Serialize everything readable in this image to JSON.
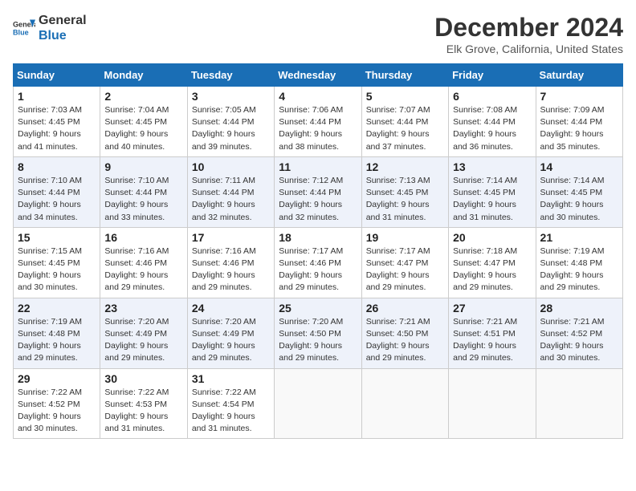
{
  "logo": {
    "line1": "General",
    "line2": "Blue"
  },
  "title": "December 2024",
  "location": "Elk Grove, California, United States",
  "days_of_week": [
    "Sunday",
    "Monday",
    "Tuesday",
    "Wednesday",
    "Thursday",
    "Friday",
    "Saturday"
  ],
  "weeks": [
    [
      {
        "day": "1",
        "info": "Sunrise: 7:03 AM\nSunset: 4:45 PM\nDaylight: 9 hours and 41 minutes."
      },
      {
        "day": "2",
        "info": "Sunrise: 7:04 AM\nSunset: 4:45 PM\nDaylight: 9 hours and 40 minutes."
      },
      {
        "day": "3",
        "info": "Sunrise: 7:05 AM\nSunset: 4:44 PM\nDaylight: 9 hours and 39 minutes."
      },
      {
        "day": "4",
        "info": "Sunrise: 7:06 AM\nSunset: 4:44 PM\nDaylight: 9 hours and 38 minutes."
      },
      {
        "day": "5",
        "info": "Sunrise: 7:07 AM\nSunset: 4:44 PM\nDaylight: 9 hours and 37 minutes."
      },
      {
        "day": "6",
        "info": "Sunrise: 7:08 AM\nSunset: 4:44 PM\nDaylight: 9 hours and 36 minutes."
      },
      {
        "day": "7",
        "info": "Sunrise: 7:09 AM\nSunset: 4:44 PM\nDaylight: 9 hours and 35 minutes."
      }
    ],
    [
      {
        "day": "8",
        "info": "Sunrise: 7:10 AM\nSunset: 4:44 PM\nDaylight: 9 hours and 34 minutes."
      },
      {
        "day": "9",
        "info": "Sunrise: 7:10 AM\nSunset: 4:44 PM\nDaylight: 9 hours and 33 minutes."
      },
      {
        "day": "10",
        "info": "Sunrise: 7:11 AM\nSunset: 4:44 PM\nDaylight: 9 hours and 32 minutes."
      },
      {
        "day": "11",
        "info": "Sunrise: 7:12 AM\nSunset: 4:44 PM\nDaylight: 9 hours and 32 minutes."
      },
      {
        "day": "12",
        "info": "Sunrise: 7:13 AM\nSunset: 4:45 PM\nDaylight: 9 hours and 31 minutes."
      },
      {
        "day": "13",
        "info": "Sunrise: 7:14 AM\nSunset: 4:45 PM\nDaylight: 9 hours and 31 minutes."
      },
      {
        "day": "14",
        "info": "Sunrise: 7:14 AM\nSunset: 4:45 PM\nDaylight: 9 hours and 30 minutes."
      }
    ],
    [
      {
        "day": "15",
        "info": "Sunrise: 7:15 AM\nSunset: 4:45 PM\nDaylight: 9 hours and 30 minutes."
      },
      {
        "day": "16",
        "info": "Sunrise: 7:16 AM\nSunset: 4:46 PM\nDaylight: 9 hours and 29 minutes."
      },
      {
        "day": "17",
        "info": "Sunrise: 7:16 AM\nSunset: 4:46 PM\nDaylight: 9 hours and 29 minutes."
      },
      {
        "day": "18",
        "info": "Sunrise: 7:17 AM\nSunset: 4:46 PM\nDaylight: 9 hours and 29 minutes."
      },
      {
        "day": "19",
        "info": "Sunrise: 7:17 AM\nSunset: 4:47 PM\nDaylight: 9 hours and 29 minutes."
      },
      {
        "day": "20",
        "info": "Sunrise: 7:18 AM\nSunset: 4:47 PM\nDaylight: 9 hours and 29 minutes."
      },
      {
        "day": "21",
        "info": "Sunrise: 7:19 AM\nSunset: 4:48 PM\nDaylight: 9 hours and 29 minutes."
      }
    ],
    [
      {
        "day": "22",
        "info": "Sunrise: 7:19 AM\nSunset: 4:48 PM\nDaylight: 9 hours and 29 minutes."
      },
      {
        "day": "23",
        "info": "Sunrise: 7:20 AM\nSunset: 4:49 PM\nDaylight: 9 hours and 29 minutes."
      },
      {
        "day": "24",
        "info": "Sunrise: 7:20 AM\nSunset: 4:49 PM\nDaylight: 9 hours and 29 minutes."
      },
      {
        "day": "25",
        "info": "Sunrise: 7:20 AM\nSunset: 4:50 PM\nDaylight: 9 hours and 29 minutes."
      },
      {
        "day": "26",
        "info": "Sunrise: 7:21 AM\nSunset: 4:50 PM\nDaylight: 9 hours and 29 minutes."
      },
      {
        "day": "27",
        "info": "Sunrise: 7:21 AM\nSunset: 4:51 PM\nDaylight: 9 hours and 29 minutes."
      },
      {
        "day": "28",
        "info": "Sunrise: 7:21 AM\nSunset: 4:52 PM\nDaylight: 9 hours and 30 minutes."
      }
    ],
    [
      {
        "day": "29",
        "info": "Sunrise: 7:22 AM\nSunset: 4:52 PM\nDaylight: 9 hours and 30 minutes."
      },
      {
        "day": "30",
        "info": "Sunrise: 7:22 AM\nSunset: 4:53 PM\nDaylight: 9 hours and 31 minutes."
      },
      {
        "day": "31",
        "info": "Sunrise: 7:22 AM\nSunset: 4:54 PM\nDaylight: 9 hours and 31 minutes."
      },
      {
        "day": "",
        "info": ""
      },
      {
        "day": "",
        "info": ""
      },
      {
        "day": "",
        "info": ""
      },
      {
        "day": "",
        "info": ""
      }
    ]
  ]
}
